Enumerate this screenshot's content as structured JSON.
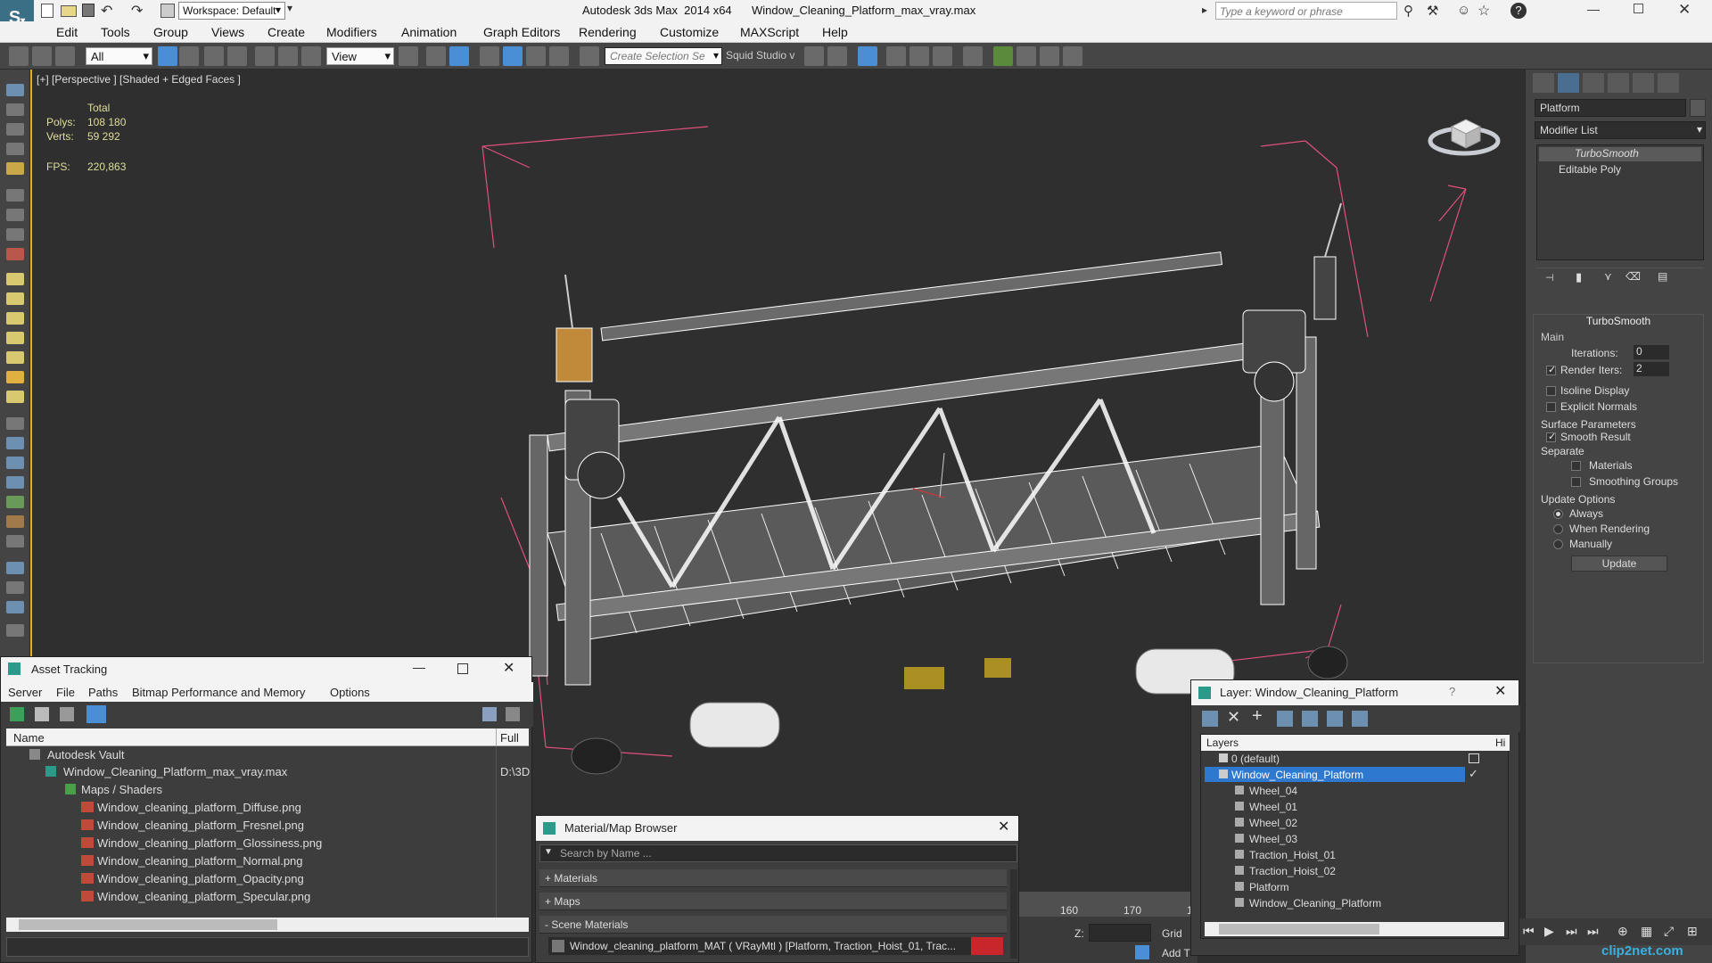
{
  "titlebar": {
    "workspace": "Workspace: Default",
    "app_title": "Autodesk 3ds Max  2014 x64",
    "file_name": "Window_Cleaning_Platform_max_vray.max",
    "search_placeholder": "Type a keyword or phrase"
  },
  "menu": [
    "Edit",
    "Tools",
    "Group",
    "Views",
    "Create",
    "Modifiers",
    "Animation",
    "Graph Editors",
    "Rendering",
    "Customize",
    "MAXScript",
    "Help"
  ],
  "toolbar": {
    "filter_value": "All",
    "coord_value": "View",
    "selection_set_placeholder": "Create Selection Se",
    "squid_label": "Squid Studio v"
  },
  "viewport": {
    "label": "[+] [Perspective ] [Shaded + Edged Faces ]",
    "stats_total": "Total",
    "polys_label": "Polys:",
    "polys_value": "108 180",
    "verts_label": "Verts:",
    "verts_value": "59 292",
    "fps_label": "FPS:",
    "fps_value": "220,863",
    "wireframe_color": "#ffffff",
    "bbox_color": "#e0507a"
  },
  "command_panel": {
    "object_name": "Platform",
    "modifier_list": "Modifier List",
    "stack": [
      "TurboSmooth",
      "Editable Poly"
    ],
    "rollout_title": "TurboSmooth",
    "main_label": "Main",
    "iterations_label": "Iterations:",
    "iterations_value": "0",
    "render_iters_label": "Render Iters:",
    "render_iters_value": "2",
    "isoline": "Isoline Display",
    "explicit_normals": "Explicit Normals",
    "surface_params": "Surface Parameters",
    "smooth_result": "Smooth Result",
    "separate": "Separate",
    "materials": "Materials",
    "smoothing_groups": "Smoothing Groups",
    "update_options": "Update Options",
    "always": "Always",
    "when_rendering": "When Rendering",
    "manually": "Manually",
    "update_button": "Update"
  },
  "asset_tracking": {
    "title": "Asset Tracking",
    "menu": [
      "Server",
      "File",
      "Paths",
      "Bitmap Performance and Memory",
      "Options"
    ],
    "col_name": "Name",
    "col_path": "Full P",
    "rows": [
      {
        "name": "Autodesk Vault",
        "path": ""
      },
      {
        "name": "Window_Cleaning_Platform_max_vray.max",
        "path": "D:\\3D"
      },
      {
        "name": "Maps / Shaders",
        "path": ""
      },
      {
        "name": "Window_cleaning_platform_Diffuse.png",
        "path": ""
      },
      {
        "name": "Window_cleaning_platform_Fresnel.png",
        "path": ""
      },
      {
        "name": "Window_cleaning_platform_Glossiness.png",
        "path": ""
      },
      {
        "name": "Window_cleaning_platform_Normal.png",
        "path": ""
      },
      {
        "name": "Window_cleaning_platform_Opacity.png",
        "path": ""
      },
      {
        "name": "Window_cleaning_platform_Specular.png",
        "path": ""
      }
    ]
  },
  "material_browser": {
    "title": "Material/Map Browser",
    "search_placeholder": "Search by Name ...",
    "sections": [
      "+ Materials",
      "+ Maps",
      "- Scene Materials"
    ],
    "scene_material": "Window_cleaning_platform_MAT  ( VRayMtl )  [Platform, Traction_Hoist_01, Trac..."
  },
  "layer_dialog": {
    "title": "Layer: Window_Cleaning_Platform",
    "help": "?",
    "col_layers": "Layers",
    "col_hide": "Hi",
    "items": [
      {
        "name": "0 (default)",
        "level": 0,
        "selected": false
      },
      {
        "name": "Window_Cleaning_Platform",
        "level": 0,
        "selected": true
      },
      {
        "name": "Wheel_04",
        "level": 1,
        "selected": false
      },
      {
        "name": "Wheel_01",
        "level": 1,
        "selected": false
      },
      {
        "name": "Wheel_02",
        "level": 1,
        "selected": false
      },
      {
        "name": "Wheel_03",
        "level": 1,
        "selected": false
      },
      {
        "name": "Traction_Hoist_01",
        "level": 1,
        "selected": false
      },
      {
        "name": "Traction_Hoist_02",
        "level": 1,
        "selected": false
      },
      {
        "name": "Platform",
        "level": 1,
        "selected": false
      },
      {
        "name": "Window_Cleaning_Platform",
        "level": 1,
        "selected": false
      }
    ]
  },
  "timeline": {
    "tick_160": "160",
    "tick_170": "170",
    "tick_1": "1",
    "z_label": "Z:",
    "grid_label": "Grid",
    "add_label": "Add T"
  },
  "watermark": "clip2net.com"
}
